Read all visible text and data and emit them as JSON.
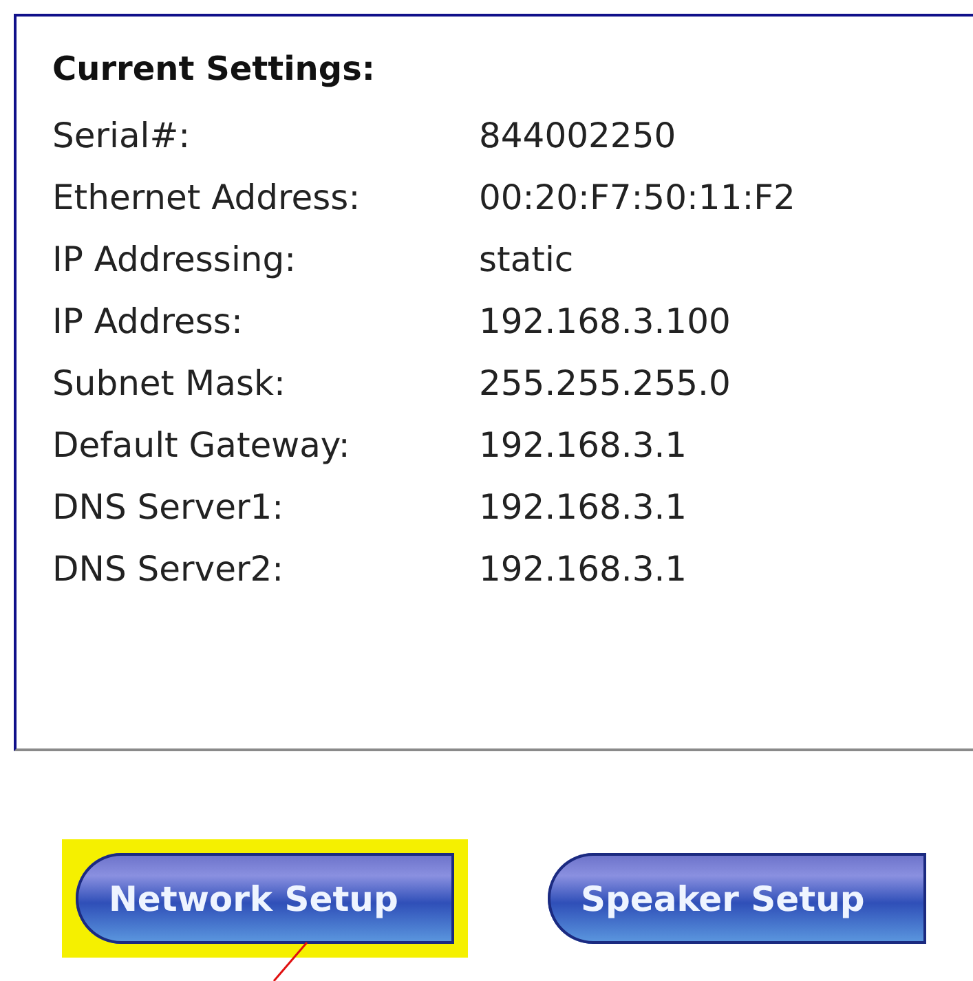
{
  "heading": "Current Settings:",
  "settings": [
    {
      "label": "Serial#:",
      "value": "844002250"
    },
    {
      "label": "Ethernet Address:",
      "value": "00:20:F7:50:11:F2"
    },
    {
      "label": "IP Addressing:",
      "value": "static"
    },
    {
      "label": "IP Address:",
      "value": "192.168.3.100"
    },
    {
      "label": "Subnet Mask:",
      "value": "255.255.255.0"
    },
    {
      "label": "Default Gateway:",
      "value": "192.168.3.1"
    },
    {
      "label": "DNS Server1:",
      "value": "192.168.3.1"
    },
    {
      "label": "DNS Server2:",
      "value": "192.168.3.1"
    }
  ],
  "buttons": [
    {
      "label": "Network Setup",
      "selected": true
    },
    {
      "label": "Speaker Setup",
      "selected": false
    }
  ]
}
